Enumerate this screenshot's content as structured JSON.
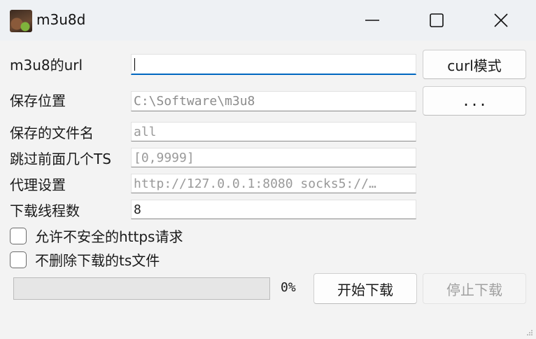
{
  "window": {
    "title": "m3u8d",
    "icon": "app-photo-icon"
  },
  "form": {
    "url": {
      "label": "m3u8的url",
      "value": ""
    },
    "save_location": {
      "label": "保存位置",
      "value": "C:\\Software\\m3u8"
    },
    "file_name": {
      "label": "保存的文件名",
      "placeholder": "all"
    },
    "skip_ts": {
      "label": "跳过前面几个TS",
      "placeholder": "[0,9999]"
    },
    "proxy": {
      "label": "代理设置",
      "placeholder": "http://127.0.0.1:8080 socks5://…"
    },
    "threads": {
      "label": "下载线程数",
      "value": "8"
    }
  },
  "buttons": {
    "curl_mode": "curl模式",
    "browse": "...",
    "start": "开始下载",
    "stop": "停止下载"
  },
  "options": {
    "insecure_https": {
      "label": "允许不安全的https请求",
      "checked": false
    },
    "keep_ts": {
      "label": "不删除下载的ts文件",
      "checked": false
    }
  },
  "progress": {
    "value": 0,
    "text": "0%"
  },
  "colors": {
    "focus_accent": "#0067c0",
    "progress_fill": "#06b025"
  }
}
